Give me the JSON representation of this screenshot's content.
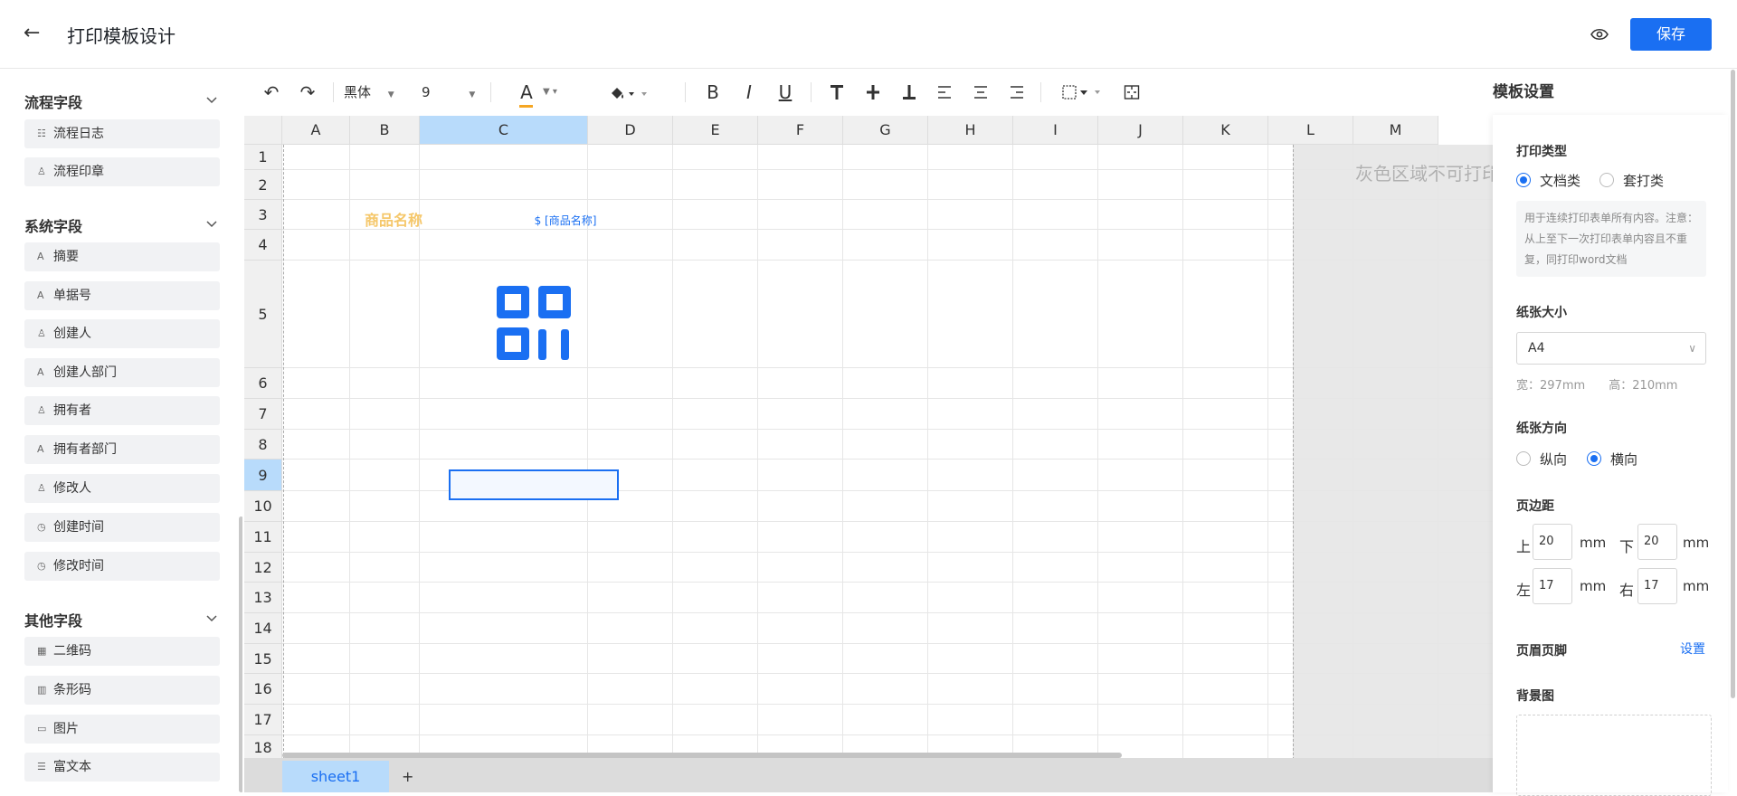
{
  "header": {
    "back_icon": "←",
    "title": "打印模板设计",
    "preview_icon": "eye-icon",
    "save_label": "保存"
  },
  "sidebar": {
    "groups": [
      {
        "title": "流程字段",
        "items": [
          {
            "icon": "list-icon",
            "glyph": "☷",
            "label": "流程日志"
          },
          {
            "icon": "stamp-icon",
            "glyph": "♙",
            "label": "流程印章"
          }
        ]
      },
      {
        "title": "系统字段",
        "items": [
          {
            "icon": "text-icon",
            "glyph": "A",
            "label": "摘要"
          },
          {
            "icon": "text-icon",
            "glyph": "A",
            "label": "单据号"
          },
          {
            "icon": "user-icon",
            "glyph": "♙",
            "label": "创建人"
          },
          {
            "icon": "text-icon",
            "glyph": "A",
            "label": "创建人部门"
          },
          {
            "icon": "user-icon",
            "glyph": "♙",
            "label": "拥有者"
          },
          {
            "icon": "text-icon",
            "glyph": "A",
            "label": "拥有者部门"
          },
          {
            "icon": "user-icon",
            "glyph": "♙",
            "label": "修改人"
          },
          {
            "icon": "clock-icon",
            "glyph": "◷",
            "label": "创建时间"
          },
          {
            "icon": "clock-icon",
            "glyph": "◷",
            "label": "修改时间"
          }
        ]
      },
      {
        "title": "其他字段",
        "items": [
          {
            "icon": "qrcode-icon",
            "glyph": "▦",
            "label": "二维码"
          },
          {
            "icon": "barcode-icon",
            "glyph": "▥",
            "label": "条形码"
          },
          {
            "icon": "image-icon",
            "glyph": "▭",
            "label": "图片"
          },
          {
            "icon": "richtext-icon",
            "glyph": "☰",
            "label": "富文本"
          }
        ]
      }
    ]
  },
  "toolbar": {
    "undo": "↶",
    "redo": "↷",
    "font_family": "黑体",
    "font_size": "9",
    "font_color_glyph": "A",
    "bold": "B",
    "italic": "I",
    "underline": "U"
  },
  "sheet": {
    "columns": [
      "A",
      "B",
      "C",
      "D",
      "E",
      "F",
      "G",
      "H",
      "I",
      "J",
      "K",
      "L",
      "M"
    ],
    "selected_column": "C",
    "rows": [
      "1",
      "2",
      "3",
      "4",
      "5",
      "6",
      "7",
      "8",
      "9",
      "10",
      "11",
      "12",
      "13",
      "14",
      "15",
      "16",
      "17",
      "18"
    ],
    "selected_row": "9",
    "cell_b3": "商品名称",
    "cell_c3": "$ [商品名称]",
    "gray_area_text": "灰色区域不可打印",
    "tab_name": "sheet1",
    "add_tab": "+"
  },
  "settings": {
    "title": "模板设置",
    "print_type_label": "打印类型",
    "print_type_options": [
      "文档类",
      "套打类"
    ],
    "print_type_selected": "文档类",
    "print_type_hint": "用于连续打印表单所有内容。注意：从上至下一次打印表单内容且不重复，同打印word文档",
    "paper_size_label": "纸张大小",
    "paper_size": "A4",
    "width_text": "宽：297mm",
    "height_text": "高：210mm",
    "orientation_label": "纸张方向",
    "orientation_options": [
      "纵向",
      "横向"
    ],
    "orientation_selected": "横向",
    "margin_label": "页边距",
    "margin_top_label": "上",
    "margin_top": "20",
    "margin_bottom_label": "下",
    "margin_bottom": "20",
    "margin_left_label": "左",
    "margin_left": "17",
    "margin_right_label": "右",
    "margin_right": "17",
    "unit": "mm",
    "header_footer_label": "页眉页脚",
    "header_footer_link": "设置",
    "background_label": "背景图"
  },
  "colors": {
    "accent": "#1a6ff2",
    "selection": "#b8dbfb",
    "field_title": "#f5c76a"
  }
}
